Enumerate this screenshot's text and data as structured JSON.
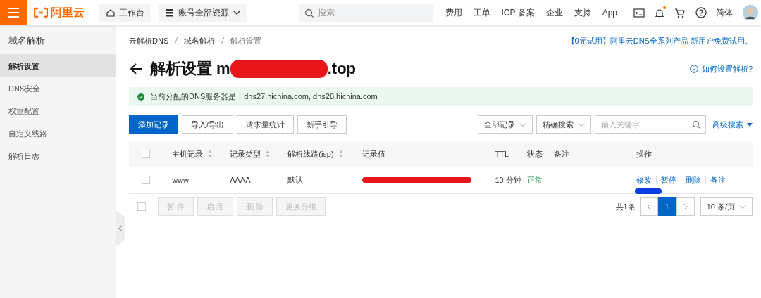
{
  "topbar": {
    "logo": "阿里云",
    "workbench": "工作台",
    "resources": "账号全部资源",
    "search": {
      "placeholder": "搜索..."
    },
    "links": [
      "费用",
      "工单",
      "ICP 备案",
      "企业",
      "支持",
      "App"
    ],
    "unread_notifications": true,
    "language": "简体"
  },
  "sidebar": {
    "title": "域名解析",
    "items": [
      {
        "label": "解析设置",
        "selected": true
      },
      {
        "label": "DNS安全",
        "selected": false
      },
      {
        "label": "权重配置",
        "selected": false
      },
      {
        "label": "自定义线路",
        "selected": false
      },
      {
        "label": "解析日志",
        "selected": false
      }
    ]
  },
  "breadcrumb": [
    "云解析DNS",
    "域名解析",
    "解析设置"
  ],
  "promo": "【0元试用】阿里云DNS全系列产品 新用户免费试用。",
  "page_title": {
    "prefix": "解析设置 m",
    "suffix": ".top",
    "redacted": true
  },
  "help_link": "如何设置解析?",
  "notice": "当前分配的DNS服务器是：dns27.hichina.com, dns28.hichina.com",
  "toolbar": {
    "buttons": [
      {
        "label": "添加记录",
        "primary": true
      },
      {
        "label": "导入/导出",
        "primary": false
      },
      {
        "label": "请求量统计",
        "primary": false
      },
      {
        "label": "新手引导",
        "primary": false
      }
    ],
    "filter": "全部记录",
    "search_mode": "精确搜索",
    "search": {
      "placeholder": "输入关键字"
    },
    "advanced": "高级搜索"
  },
  "table": {
    "columns": [
      {
        "label": "主机记录",
        "sortable": true
      },
      {
        "label": "记录类型",
        "sortable": true
      },
      {
        "label": "解析线路(isp)",
        "sortable": true
      },
      {
        "label": "记录值",
        "sortable": false
      },
      {
        "label": "TTL",
        "sortable": false
      },
      {
        "label": "状态",
        "sortable": false
      },
      {
        "label": "备注",
        "sortable": false
      },
      {
        "label": "操作",
        "sortable": false
      }
    ],
    "header_checked": false,
    "rows": [
      {
        "checked": false,
        "host": "www",
        "type": "AAAA",
        "line": "默认",
        "value_redacted": true,
        "ttl": "10 分钟",
        "status": "正常",
        "actions": [
          "修改",
          "暂停",
          "删除",
          "备注"
        ],
        "action_redacted": true
      }
    ]
  },
  "bulk": {
    "checked": false,
    "buttons": [
      {
        "label": "暂 停",
        "disabled": true
      },
      {
        "label": "启 用",
        "disabled": true
      },
      {
        "label": "删 除",
        "disabled": true
      },
      {
        "label": "更换分组",
        "disabled": true
      }
    ]
  },
  "pagination": {
    "total": "共1条",
    "pages": [
      {
        "label": "1",
        "selected": true
      }
    ],
    "page_size": "10 条/页"
  }
}
